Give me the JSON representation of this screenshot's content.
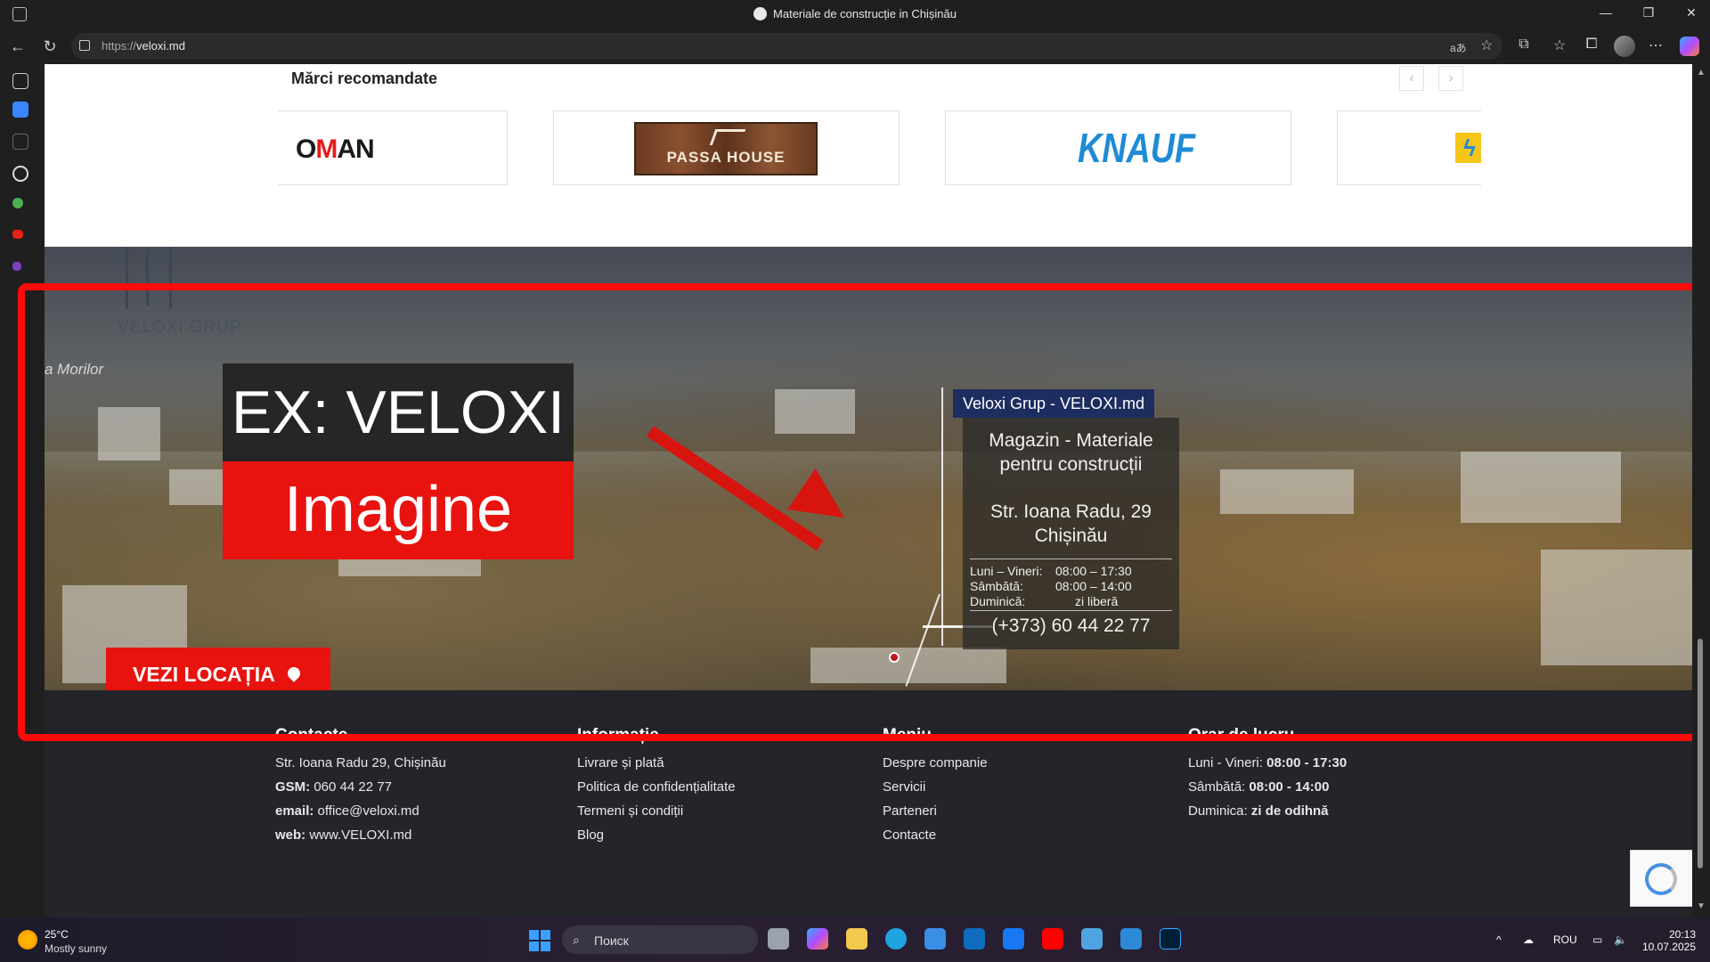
{
  "browser": {
    "window_title": "Materiale de construcție in Chișinău",
    "url_protocol": "https://",
    "url_host": "veloxi.md"
  },
  "brands": {
    "heading": "Mărci recomandate",
    "prev_icon": "‹",
    "next_icon": "›",
    "logos": [
      "OMAN",
      "PASSA HOUSE",
      "KNAUF"
    ]
  },
  "hero": {
    "logo_name": "VELOXI GRUP",
    "street_label": "a Morilor",
    "ex_label": "EX: VELOXI",
    "image_label": "Imagine",
    "map_tag": "Veloxi Grup - VELOXI.md",
    "card": {
      "line1": "Magazin - Materiale pentru construcții",
      "line2": "Str. Ioana Radu, 29 Chișinău",
      "hours": [
        {
          "day": "Luni – Vineri:",
          "time": "08:00 – 17:30"
        },
        {
          "day": "Sâmbătă:",
          "time": "08:00 – 14:00"
        },
        {
          "day": "Duminică:",
          "time": "zi liberă"
        }
      ],
      "phone": "(+373) 60 44 22 77"
    },
    "vezi_button": "VEZI LOCAȚIA"
  },
  "footer": {
    "contacte": {
      "heading": "Contacte",
      "address": "Str. Ioana Radu 29, Chișinău",
      "gsm_label": "GSM:",
      "gsm_value": "060 44 22 77",
      "email_label": "email:",
      "email_value": "office@veloxi.md",
      "web_label": "web:",
      "web_value": "www.VELOXI.md"
    },
    "informatie": {
      "heading": "Informație",
      "links": [
        "Livrare și plată",
        "Politica de confidențialitate",
        "Termeni și condiții",
        "Blog"
      ]
    },
    "meniu": {
      "heading": "Meniu",
      "links": [
        "Despre companie",
        "Servicii",
        "Parteneri",
        "Contacte"
      ]
    },
    "orar": {
      "heading": "Orar de lucru",
      "rows": [
        {
          "label": "Luni - Vineri:",
          "value": "08:00 - 17:30"
        },
        {
          "label": "Sâmbătă:",
          "value": "08:00 - 14:00"
        },
        {
          "label": "Duminica:",
          "value": "zi de odihnă"
        }
      ]
    }
  },
  "taskbar": {
    "weather_temp": "25°C",
    "weather_desc": "Mostly sunny",
    "search_label": "Поиск",
    "language": "ROU",
    "time": "20:13",
    "date": "10.07.2025"
  },
  "colors": {
    "accent_red": "#e8130f",
    "annotation_red": "#ff0a0a",
    "footer_bg": "#23252b",
    "map_tag_blue": "#1d2d5f"
  }
}
